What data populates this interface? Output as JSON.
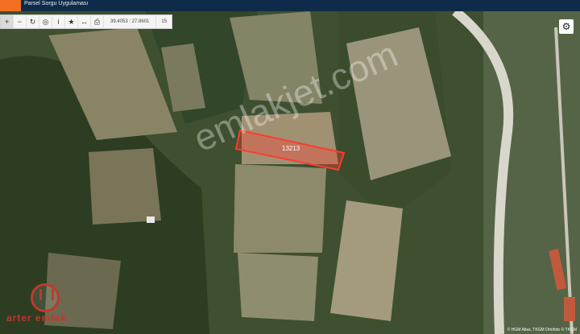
{
  "app": {
    "title": "Parsel Sorgu Uygulaması"
  },
  "toolbar": {
    "icons": [
      "plus-icon",
      "minus-icon",
      "refresh-icon",
      "locate-icon",
      "info-icon",
      "star-icon",
      "measure-icon",
      "print-icon"
    ],
    "coordinates": "39.4053 : 27.8601",
    "zoom": "15"
  },
  "map": {
    "parcel_label": "13213",
    "watermark": "emlakjet.com",
    "parcel_color": "#ff3b30",
    "attribution": "© HGM Atlas, TKGM Ortofoto © TKGM"
  },
  "brand": {
    "name": "arter emlak",
    "color": "#c0392b"
  }
}
